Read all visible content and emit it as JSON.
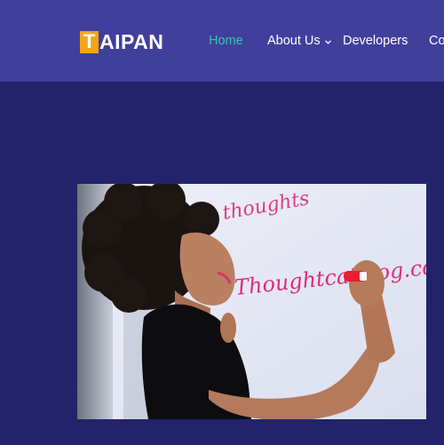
{
  "header": {
    "logo": {
      "badge_letter": "T",
      "rest": "AIPAN"
    },
    "nav": [
      {
        "label": "Home",
        "active": true
      },
      {
        "label": "About Us",
        "has_dropdown": true
      },
      {
        "label": "Developers"
      },
      {
        "label": "Co"
      }
    ]
  },
  "hero": {
    "whiteboard_text_1": "Thoughtcatalog.co",
    "whiteboard_text_2": "thoughts"
  },
  "colors": {
    "header_bg": "#413f9c",
    "page_bg": "#22236a",
    "active_link": "#34c4b0",
    "logo_badge": "#f3a41a"
  },
  "icons": [
    "chevron-down-icon"
  ]
}
